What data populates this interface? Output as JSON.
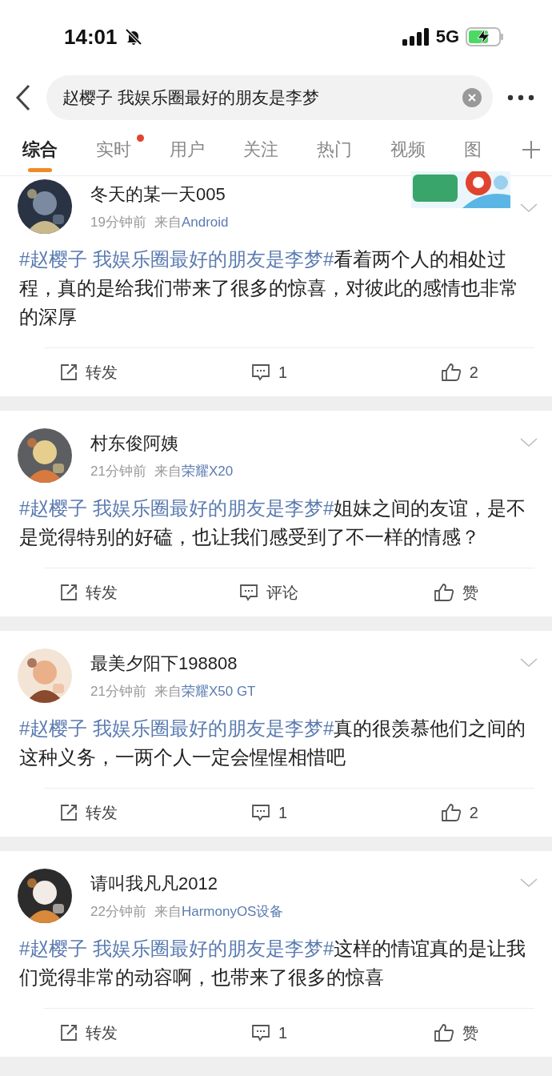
{
  "status_bar": {
    "time": "14:01",
    "muted": true,
    "network": "5G",
    "charging": true
  },
  "search": {
    "value": "赵樱子 我娱乐圈最好的朋友是李梦"
  },
  "tabs": [
    {
      "label": "综合",
      "selected": true,
      "dot": false
    },
    {
      "label": "实时",
      "selected": false,
      "dot": true
    },
    {
      "label": "用户",
      "selected": false,
      "dot": false
    },
    {
      "label": "关注",
      "selected": false,
      "dot": false
    },
    {
      "label": "热门",
      "selected": false,
      "dot": false
    },
    {
      "label": "视频",
      "selected": false,
      "dot": false
    },
    {
      "label": "图",
      "selected": false,
      "dot": false
    }
  ],
  "posts": [
    {
      "name": "冬天的某一天005",
      "time": "19分钟前",
      "source_prefix": "来自",
      "source": "Android",
      "hashtag": "#赵樱子 我娱乐圈最好的朋友是李梦#",
      "text": "看着两个人的相处过程，真的是给我们带来了很多的惊喜，对彼此的感情也非常的深厚",
      "repost": "转发",
      "comment": "1",
      "like": "2"
    },
    {
      "name": "村东俊阿姨",
      "time": "21分钟前",
      "source_prefix": "来自",
      "source": "荣耀X20",
      "hashtag": "#赵樱子 我娱乐圈最好的朋友是李梦#",
      "text": "姐妹之间的友谊，是不是觉得特别的好磕，也让我们感受到了不一样的情感？",
      "repost": "转发",
      "comment": "评论",
      "like": "赞"
    },
    {
      "name": "最美夕阳下198808",
      "time": "21分钟前",
      "source_prefix": "来自",
      "source": "荣耀X50 GT",
      "hashtag": "#赵樱子 我娱乐圈最好的朋友是李梦#",
      "text": "真的很羡慕他们之间的这种义务，一两个人一定会惺惺相惜吧",
      "repost": "转发",
      "comment": "1",
      "like": "2"
    },
    {
      "name": "请叫我凡凡2012",
      "time": "22分钟前",
      "source_prefix": "来自",
      "source": "HarmonyOS设备",
      "hashtag": "#赵樱子 我娱乐圈最好的朋友是李梦#",
      "text": "这样的情谊真的是让我们觉得非常的动容啊，也带来了很多的惊喜",
      "repost": "转发",
      "comment": "1",
      "like": "赞"
    }
  ]
}
